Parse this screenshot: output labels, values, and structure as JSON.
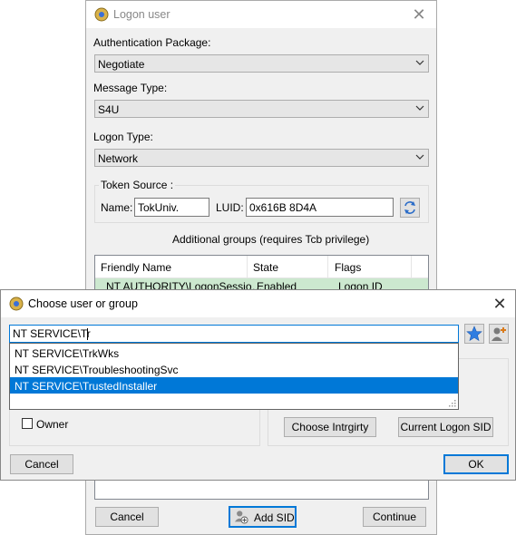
{
  "logon_dialog": {
    "title": "Logon user",
    "auth_package_label": "Authentication Package:",
    "auth_package_value": "Negotiate",
    "message_type_label": "Message Type:",
    "message_type_value": "S4U",
    "logon_type_label": "Logon Type:",
    "logon_type_value": "Network",
    "token_source_label": "Token Source :",
    "name_label": "Name:",
    "name_value": "TokUniv.",
    "luid_label": "LUID:",
    "luid_value": "0x616B 8D4A",
    "groups_caption": "Additional groups (requires Tcb privilege)",
    "columns": [
      "Friendly Name",
      "State",
      "Flags"
    ],
    "row": {
      "name": "NT AUTHORITY\\LogonSessio…",
      "state": "Enabled",
      "flags": "Logon ID"
    },
    "cancel_label": "Cancel",
    "add_sid_label": "Add SID",
    "continue_label": "Continue"
  },
  "choose_dialog": {
    "title": "Choose user or group",
    "search_value": "NT SERVICE\\Tr",
    "suggestions": [
      "NT SERVICE\\TrkWks",
      "NT SERVICE\\TroubleshootingSvc",
      "NT SERVICE\\TrustedInstaller"
    ],
    "selected_index": 2,
    "owner_label": "Owner",
    "choose_integrity_label": "Choose Intrgirty",
    "current_logon_sid_label": "Current Logon SID",
    "cancel_label": "Cancel",
    "ok_label": "OK"
  },
  "colors": {
    "accent": "#0078d7",
    "selected_row": "#cce8cf"
  },
  "icons": [
    "app-icon",
    "close-icon",
    "chevron-down-icon",
    "refresh-icon",
    "star-icon",
    "user-add-icon"
  ]
}
